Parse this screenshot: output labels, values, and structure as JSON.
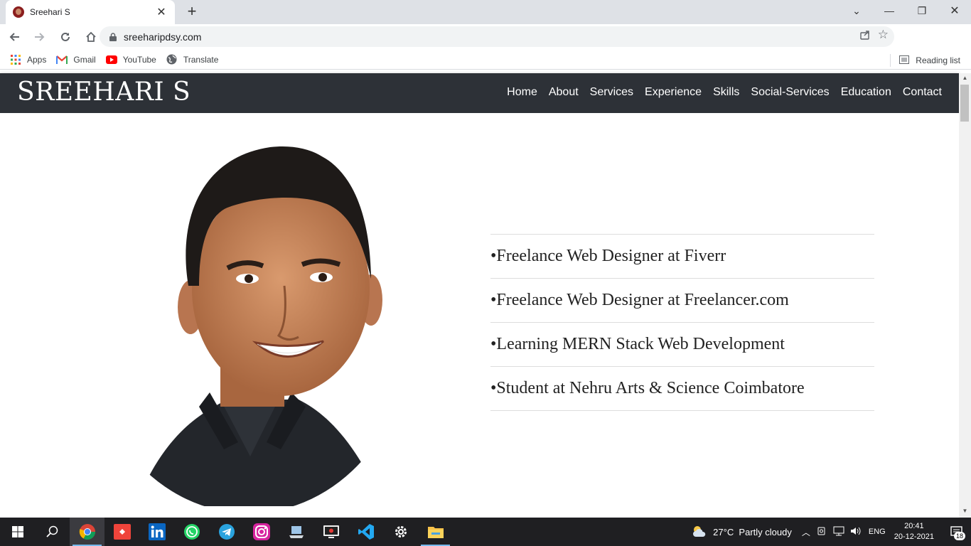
{
  "browser": {
    "tab_title": "Sreehari S",
    "url": "sreeharipdsy.com",
    "bookmarks": [
      "Apps",
      "Gmail",
      "YouTube",
      "Translate"
    ],
    "reading_list": "Reading list"
  },
  "site": {
    "brand": "SREEHARI S",
    "nav": [
      "Home",
      "About",
      "Services",
      "Experience",
      "Skills",
      "Social-Services",
      "Education",
      "Contact"
    ],
    "roles": [
      "•Freelance Web Designer at Fiverr",
      "•Freelance Web Designer at Freelancer.com",
      "•Learning MERN Stack Web Development",
      "•Student at Nehru Arts & Science Coimbatore"
    ]
  },
  "taskbar": {
    "apps": [
      "start-icon",
      "search-icon",
      "chrome-icon",
      "anydesk-icon",
      "linkedin-icon",
      "whatsapp-icon",
      "telegram-icon",
      "instagram-icon",
      "computer-icon",
      "screen-recorder-icon",
      "vscode-icon",
      "settings-icon",
      "file-explorer-icon"
    ],
    "weather": "27°C  Partly cloudy",
    "lang": "ENG",
    "time": "20:41",
    "date": "20-12-2021",
    "notifications": "18"
  }
}
